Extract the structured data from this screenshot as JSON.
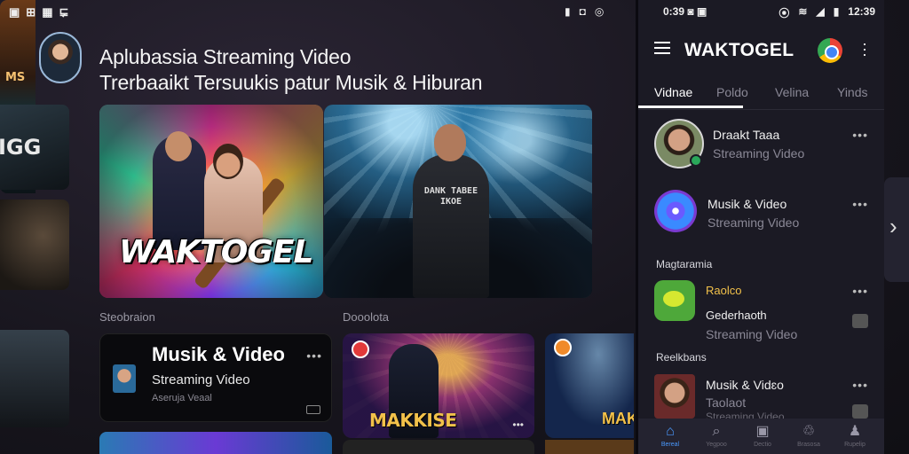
{
  "status_left": [
    "▣",
    "⊞",
    "▦",
    "⋤"
  ],
  "status_mid": [
    "▮",
    "◘",
    "◎"
  ],
  "headline": {
    "line1": "Aplubassia Streaming Video",
    "line2": "Trerbaaikt Tersuukis patur Musik & Hiburan"
  },
  "left_edge": {
    "thumb1_text": "IGG"
  },
  "hero": {
    "brand": "WAKTOGEL",
    "shirt_text": "DANK TABEE IKOE",
    "side_text": "MS"
  },
  "sections": {
    "left_label": "Steobraion",
    "right_label": "Dooolota"
  },
  "mv_card": {
    "title": "Musik & Video",
    "subtitle": "Streaming Video",
    "meta": "Aseruja Veaal",
    "more": "•••"
  },
  "mk_card": {
    "title": "MAKKISE",
    "dots": "•••"
  },
  "mk2_card": {
    "title": "MAK"
  },
  "phone": {
    "status_time": "0:39",
    "status_icons": [
      "◙",
      "▣"
    ],
    "status_right": [
      "⦿",
      "≋",
      "◢",
      "▮",
      "12:39"
    ],
    "title": "WAKTOGEL",
    "tabs": [
      "Vidnae",
      "Poldo",
      "Velina",
      "Yinds"
    ],
    "rows": [
      {
        "name": "Draakt Taaa",
        "sub": "Streaming Video",
        "more": "•••"
      },
      {
        "name": "Musik & Video",
        "sub": "Streaming Video",
        "more": "•••"
      },
      {
        "name": "Raolco",
        "name2": "Gederhaoth",
        "sub": "Streaming Video",
        "more": "•••"
      },
      {
        "name": "Musik & Vidɛo",
        "sub": "Taolaot",
        "sub2": "Streaming Video",
        "more": "•••"
      }
    ],
    "subheaders": [
      "Magtaramia",
      "Reelkbans"
    ],
    "bottom_nav": [
      {
        "icon": "⌂",
        "label": "Bereal"
      },
      {
        "icon": "⌕",
        "label": "Yegpoo"
      },
      {
        "icon": "▣",
        "label": "Dectio"
      },
      {
        "icon": "♲",
        "label": "Brasosa"
      },
      {
        "icon": "♟",
        "label": "Rupelip"
      }
    ]
  },
  "side_handle": "›"
}
